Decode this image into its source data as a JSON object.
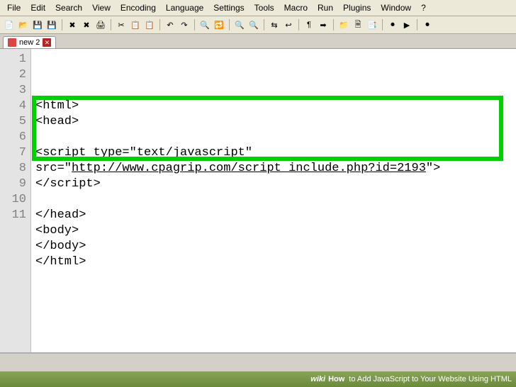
{
  "menu": [
    "File",
    "Edit",
    "Search",
    "View",
    "Encoding",
    "Language",
    "Settings",
    "Tools",
    "Macro",
    "Run",
    "Plugins",
    "Window",
    "?"
  ],
  "toolbar_icons": [
    {
      "name": "new-file-icon",
      "glyph": "📄"
    },
    {
      "name": "open-file-icon",
      "glyph": "📂"
    },
    {
      "name": "save-icon",
      "glyph": "💾"
    },
    {
      "name": "save-all-icon",
      "glyph": "💾"
    },
    {
      "name": "sep"
    },
    {
      "name": "close-icon",
      "glyph": "✖"
    },
    {
      "name": "close-all-icon",
      "glyph": "✖"
    },
    {
      "name": "print-icon",
      "glyph": "🖨"
    },
    {
      "name": "sep"
    },
    {
      "name": "cut-icon",
      "glyph": "✂"
    },
    {
      "name": "copy-icon",
      "glyph": "📋"
    },
    {
      "name": "paste-icon",
      "glyph": "📋"
    },
    {
      "name": "sep"
    },
    {
      "name": "undo-icon",
      "glyph": "↶"
    },
    {
      "name": "redo-icon",
      "glyph": "↷"
    },
    {
      "name": "sep"
    },
    {
      "name": "find-icon",
      "glyph": "🔍"
    },
    {
      "name": "replace-icon",
      "glyph": "🔁"
    },
    {
      "name": "sep"
    },
    {
      "name": "zoom-in-icon",
      "glyph": "🔍"
    },
    {
      "name": "zoom-out-icon",
      "glyph": "🔍"
    },
    {
      "name": "sep"
    },
    {
      "name": "sync-icon",
      "glyph": "⇆"
    },
    {
      "name": "wrap-icon",
      "glyph": "↩"
    },
    {
      "name": "sep"
    },
    {
      "name": "show-chars-icon",
      "glyph": "¶"
    },
    {
      "name": "indent-icon",
      "glyph": "➡"
    },
    {
      "name": "sep"
    },
    {
      "name": "folder-icon",
      "glyph": "📁"
    },
    {
      "name": "doc-map-icon",
      "glyph": "🗎"
    },
    {
      "name": "func-list-icon",
      "glyph": "📑"
    },
    {
      "name": "sep"
    },
    {
      "name": "macro-rec-icon",
      "glyph": "⏺"
    },
    {
      "name": "macro-play-icon",
      "glyph": "▶"
    },
    {
      "name": "sep"
    },
    {
      "name": "record-icon",
      "glyph": "⏺"
    }
  ],
  "tab": {
    "label": "new 2",
    "close": "✕"
  },
  "code_lines": [
    {
      "n": 1,
      "t": "<html>"
    },
    {
      "n": 2,
      "t": "<head>"
    },
    {
      "n": 3,
      "t": ""
    },
    {
      "n": 4,
      "t": "<script type=\"text/javascript\""
    },
    {
      "n": 5,
      "t": "src=\"",
      "link": "http://www.cpagrip.com/script_include.php?id=2193",
      "tail": "\">"
    },
    {
      "n": 6,
      "t": "</script>"
    },
    {
      "n": 7,
      "t": ""
    },
    {
      "n": 8,
      "t": "</head>"
    },
    {
      "n": 9,
      "t": "<body>"
    },
    {
      "n": 10,
      "t": "</body>"
    },
    {
      "n": 11,
      "t": "</html>"
    }
  ],
  "footer": {
    "brand": "wiki",
    "how": "How",
    "title": "to Add JavaScript to Your Website Using HTML"
  }
}
